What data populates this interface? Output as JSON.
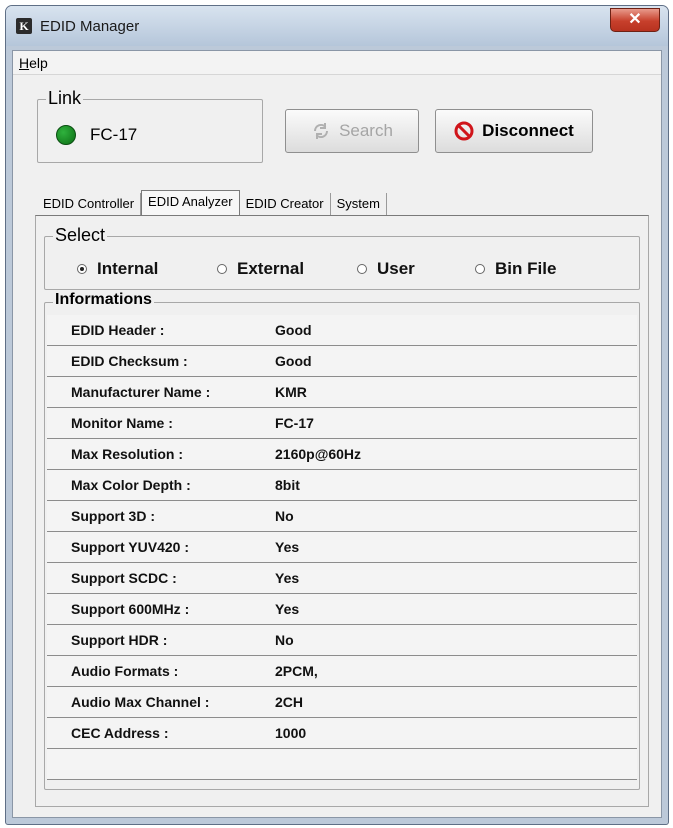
{
  "window": {
    "title": "EDID Manager",
    "app_icon_glyph": "K",
    "close_glyph": "✕"
  },
  "menu": {
    "help_label_u": "H",
    "help_label_rest": "elp"
  },
  "link": {
    "label": "Link",
    "device_name": "FC-17",
    "status_color": "#1a9b28"
  },
  "buttons": {
    "search_label": "Search",
    "disconnect_label": "Disconnect"
  },
  "tabs": [
    {
      "label": "EDID Controller",
      "active": false
    },
    {
      "label": "EDID Analyzer",
      "active": true
    },
    {
      "label": "EDID Creator",
      "active": false
    },
    {
      "label": "System",
      "active": false
    }
  ],
  "select": {
    "label": "Select",
    "options": [
      {
        "label": "Internal",
        "selected": true
      },
      {
        "label": "External",
        "selected": false
      },
      {
        "label": "User",
        "selected": false
      },
      {
        "label": "Bin File",
        "selected": false
      }
    ]
  },
  "informations": {
    "label": "Informations",
    "rows": [
      {
        "key": "EDID Header :",
        "value": "Good"
      },
      {
        "key": "EDID Checksum :",
        "value": "Good"
      },
      {
        "key": "Manufacturer Name :",
        "value": "KMR"
      },
      {
        "key": "Monitor Name :",
        "value": "FC-17"
      },
      {
        "key": "Max Resolution :",
        "value": "2160p@60Hz"
      },
      {
        "key": "Max Color Depth :",
        "value": "8bit"
      },
      {
        "key": "Support 3D :",
        "value": "No"
      },
      {
        "key": "Support YUV420 :",
        "value": "Yes"
      },
      {
        "key": "Support SCDC :",
        "value": "Yes"
      },
      {
        "key": "Support 600MHz :",
        "value": "Yes"
      },
      {
        "key": "Support HDR :",
        "value": "No"
      },
      {
        "key": "Audio Formats :",
        "value": "2PCM,"
      },
      {
        "key": "Audio Max Channel :",
        "value": "2CH"
      },
      {
        "key": "CEC Address :",
        "value": "1000"
      }
    ]
  }
}
